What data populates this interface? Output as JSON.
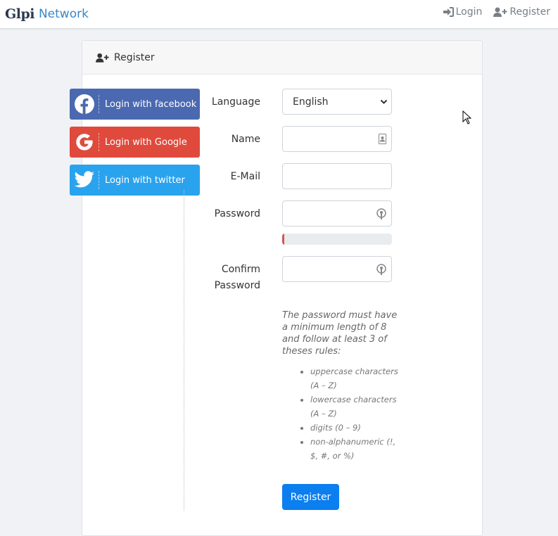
{
  "navbar": {
    "logo_text": "Glpi",
    "brand_name": "Network",
    "login_label": "Login",
    "register_label": "Register"
  },
  "card": {
    "header_title": "Register"
  },
  "social": {
    "facebook_label": "Login with facebook",
    "google_label": "Login with Google",
    "twitter_label": "Login with twitter",
    "colors": {
      "facebook": "#4a69b1",
      "google": "#e04a3d",
      "twitter": "#2aa3ef"
    }
  },
  "form": {
    "language_label": "Language",
    "language_value": "English",
    "name_label": "Name",
    "name_value": "",
    "email_label": "E-Mail",
    "email_value": "",
    "password_label": "Password",
    "password_value": "",
    "password_strength": 0.02,
    "confirm_label_1": "Confirm",
    "confirm_label_2": "Password",
    "confirm_value": ""
  },
  "rules": {
    "intro": "The password must have a minimum length of 8 and follow at least 3 of theses rules:",
    "items": [
      "uppercase characters (A – Z)",
      "lowercase characters (A – Z)",
      "digits (0 – 9)",
      "non-alphanumeric (!, $, #, or %)"
    ]
  },
  "submit_label": "Register",
  "colors": {
    "accent": "#0b7ef0",
    "strength_bar": "#d9534f"
  }
}
